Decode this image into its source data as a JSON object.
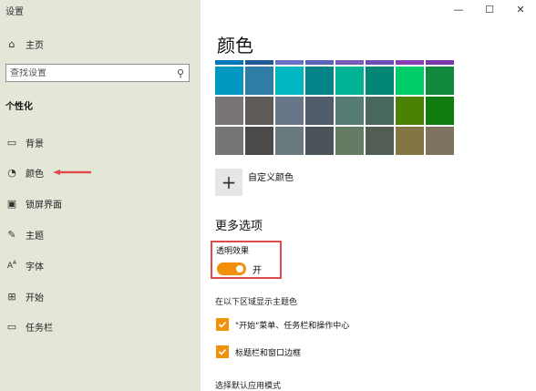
{
  "window": {
    "title": "设置"
  },
  "sidebar": {
    "home": "主页",
    "search_placeholder": "查找设置",
    "section": "个性化",
    "items": [
      {
        "label": "背景",
        "icon": "image-icon"
      },
      {
        "label": "颜色",
        "icon": "palette-icon"
      },
      {
        "label": "锁屏界面",
        "icon": "lock-screen-icon"
      },
      {
        "label": "主题",
        "icon": "theme-icon"
      },
      {
        "label": "字体",
        "icon": "font-icon"
      },
      {
        "label": "开始",
        "icon": "start-icon"
      },
      {
        "label": "任务栏",
        "icon": "taskbar-icon"
      }
    ]
  },
  "main": {
    "title": "颜色",
    "swatches_top": [
      "#0077b8",
      "#1e5a98",
      "#6a72c8",
      "#5a64b8",
      "#7b5bb8",
      "#6c4fb4",
      "#8a3fb2",
      "#7a38a8"
    ],
    "swatches": [
      "#0398c2",
      "#2d7da6",
      "#00b7c3",
      "#038387",
      "#00b294",
      "#018574",
      "#00cc6a",
      "#10893e",
      "#7a7574",
      "#5d5a58",
      "#68768a",
      "#515c6b",
      "#567c73",
      "#486860",
      "#498205",
      "#107c10",
      "#767676",
      "#4c4a48",
      "#69797e",
      "#4a5459",
      "#647c64",
      "#525e54",
      "#847545",
      "#7e735f"
    ],
    "custom_color_label": "自定义颜色",
    "more_options": "更多选项",
    "transparency_label": "透明效果",
    "transparency_state": "开",
    "accent_surfaces_label": "在以下区域显示主题色",
    "checkbox_start": "\"开始\"菜单、任务栏和操作中心",
    "checkbox_titlebar": "标题栏和窗口边框",
    "default_app_mode": "选择默认应用模式"
  },
  "colors": {
    "accent": "#f0900b",
    "highlight": "#e04a4a",
    "sidebar_bg": "#e3e7d8"
  }
}
